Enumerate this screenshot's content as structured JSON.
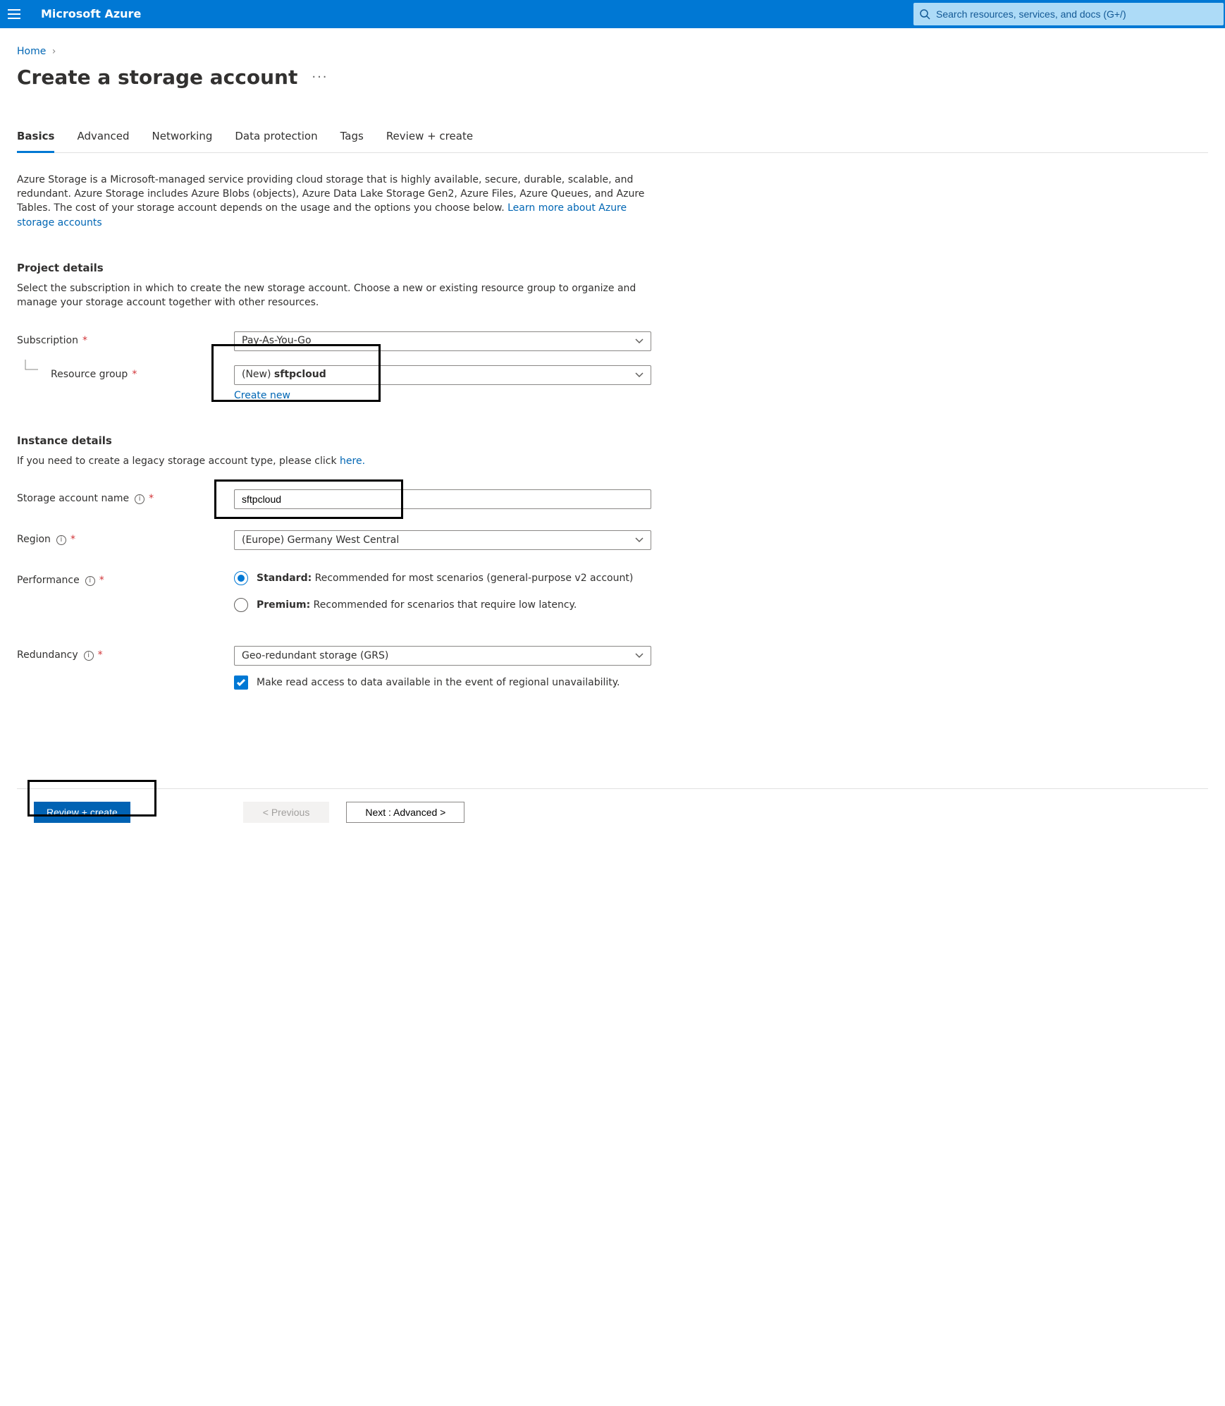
{
  "topbar": {
    "brand": "Microsoft Azure",
    "search_placeholder": "Search resources, services, and docs (G+/)"
  },
  "breadcrumb": {
    "home": "Home"
  },
  "page_title": "Create a storage account",
  "tabs": [
    "Basics",
    "Advanced",
    "Networking",
    "Data protection",
    "Tags",
    "Review + create"
  ],
  "intro_text": "Azure Storage is a Microsoft-managed service providing cloud storage that is highly available, secure, durable, scalable, and redundant. Azure Storage includes Azure Blobs (objects), Azure Data Lake Storage Gen2, Azure Files, Azure Queues, and Azure Tables. The cost of your storage account depends on the usage and the options you choose below. ",
  "intro_link": "Learn more about Azure storage accounts",
  "project": {
    "title": "Project details",
    "desc": "Select the subscription in which to create the new storage account. Choose a new or existing resource group to organize and manage your storage account together with other resources.",
    "subscription_label": "Subscription",
    "subscription_value": "Pay-As-You-Go",
    "rg_label": "Resource group",
    "rg_prefix": "(New) ",
    "rg_value": "sftpcloud",
    "rg_create_new": "Create new"
  },
  "instance": {
    "title": "Instance details",
    "desc_pre": "If you need to create a legacy storage account type, please click ",
    "desc_link": "here.",
    "name_label": "Storage account name",
    "name_value": "sftpcloud",
    "region_label": "Region",
    "region_value": "(Europe) Germany West Central",
    "perf_label": "Performance",
    "perf_standard_bold": "Standard:",
    "perf_standard_rest": " Recommended for most scenarios (general-purpose v2 account)",
    "perf_premium_bold": "Premium:",
    "perf_premium_rest": " Recommended for scenarios that require low latency.",
    "redundancy_label": "Redundancy",
    "redundancy_value": "Geo-redundant storage (GRS)",
    "readaccess_label": "Make read access to data available in the event of regional unavailability."
  },
  "footer": {
    "review": "Review + create",
    "previous": "< Previous",
    "next": "Next : Advanced >"
  }
}
